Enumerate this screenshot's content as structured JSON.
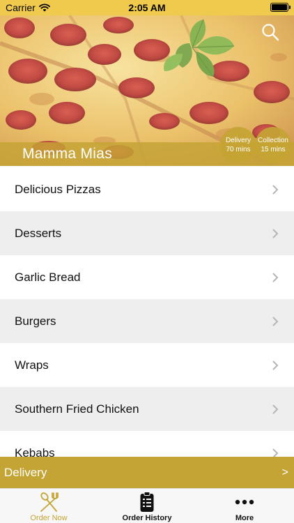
{
  "status_bar": {
    "carrier": "Carrier",
    "time": "2:05 AM",
    "battery_level": 1.0
  },
  "hero": {
    "restaurant_name": "Mamma Mias",
    "search_icon": "search-icon",
    "delivery_badge": {
      "label": "Delivery",
      "time": "70 mins"
    },
    "collection_badge": {
      "label": "Collection",
      "time": "15 mins"
    }
  },
  "menu": {
    "items": [
      {
        "label": "Delicious Pizzas"
      },
      {
        "label": "Desserts"
      },
      {
        "label": "Garlic Bread"
      },
      {
        "label": "Burgers"
      },
      {
        "label": "Wraps"
      },
      {
        "label": "Southern Fried Chicken"
      },
      {
        "label": "Kebabs"
      }
    ],
    "chevron_icon": "chevron-right-icon"
  },
  "delivery_bar": {
    "label": "Delivery",
    "arrow": ">"
  },
  "tabs": [
    {
      "label": "Order Now",
      "icon": "fork-knife-icon",
      "active": true
    },
    {
      "label": "Order History",
      "icon": "clipboard-icon",
      "active": false
    },
    {
      "label": "More",
      "icon": "more-dots-icon",
      "active": false
    }
  ],
  "colors": {
    "accent": "#c4a434",
    "status_bar": "#f0ca4d",
    "tab_bar": "#f7f7f7",
    "row_alt": "#eeeeee"
  }
}
